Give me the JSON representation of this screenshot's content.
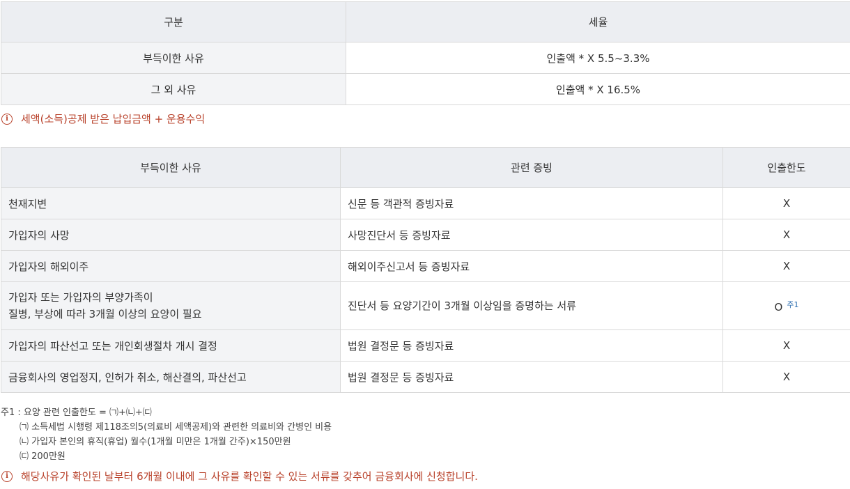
{
  "tax_table": {
    "headers": [
      "구분",
      "세율"
    ],
    "rows": [
      {
        "label": "부득이한 사유",
        "value": "인출액 *  X 5.5~3.3%"
      },
      {
        "label": "그 외 사유",
        "value": "인출액 * X 16.5%"
      }
    ]
  },
  "note1": "세액(소득)공제 받은 납입금액 + 운용수익",
  "reason_table": {
    "headers": [
      "부득이한 사유",
      "관련 증빙",
      "인출한도"
    ],
    "rows": [
      {
        "reason": "천재지변",
        "proof": "신문 등 객관적 증빙자료",
        "limit": "X"
      },
      {
        "reason": "가입자의 사망",
        "proof": "사망진단서 등 증빙자료",
        "limit": "X"
      },
      {
        "reason": "가입자의 해외이주",
        "proof": "해외이주신고서 등 증빙자료",
        "limit": "X"
      },
      {
        "reason_line1": "가입자 또는 가입자의 부양가족이",
        "reason_line2": "질병, 부상에 따라 3개월 이상의 요양이 필요",
        "proof": "진단서 등 요양기간이 3개월 이상임을 증명하는 서류",
        "limit": "O",
        "limit_note": "주1"
      },
      {
        "reason": "가입자의 파산선고 또는 개인회생절차 개시 결정",
        "proof": "법원 결정문 등 증빙자료",
        "limit": "X"
      },
      {
        "reason": "금융회사의 영업정지, 인허가 취소, 해산결의, 파산선고",
        "proof": "법원 결정문 등 증빙자료",
        "limit": "X"
      }
    ]
  },
  "footnote": {
    "title": "주1 : 요양 관련 인출한도 = ㈀+㈁+㈂",
    "items": [
      "㈀ 소득세법 시행령 제118조의5(의료비 세액공제)와 관련한 의료비와 간병인 비용",
      "㈁ 가입자 본인의 휴직(휴업) 월수(1개월 미만은 1개월 간주)×150만원",
      "㈂ 200만원"
    ]
  },
  "note2": "해당사유가 확인된 날부터 6개월 이내에 그 사유를 확인할 수 있는 서류를 갖추어 금융회사에 신청합니다.",
  "colors": {
    "note": "#b8412a",
    "header_bg": "#eceef2",
    "label_bg": "#f3f4f6",
    "border": "#d9d9d9"
  }
}
